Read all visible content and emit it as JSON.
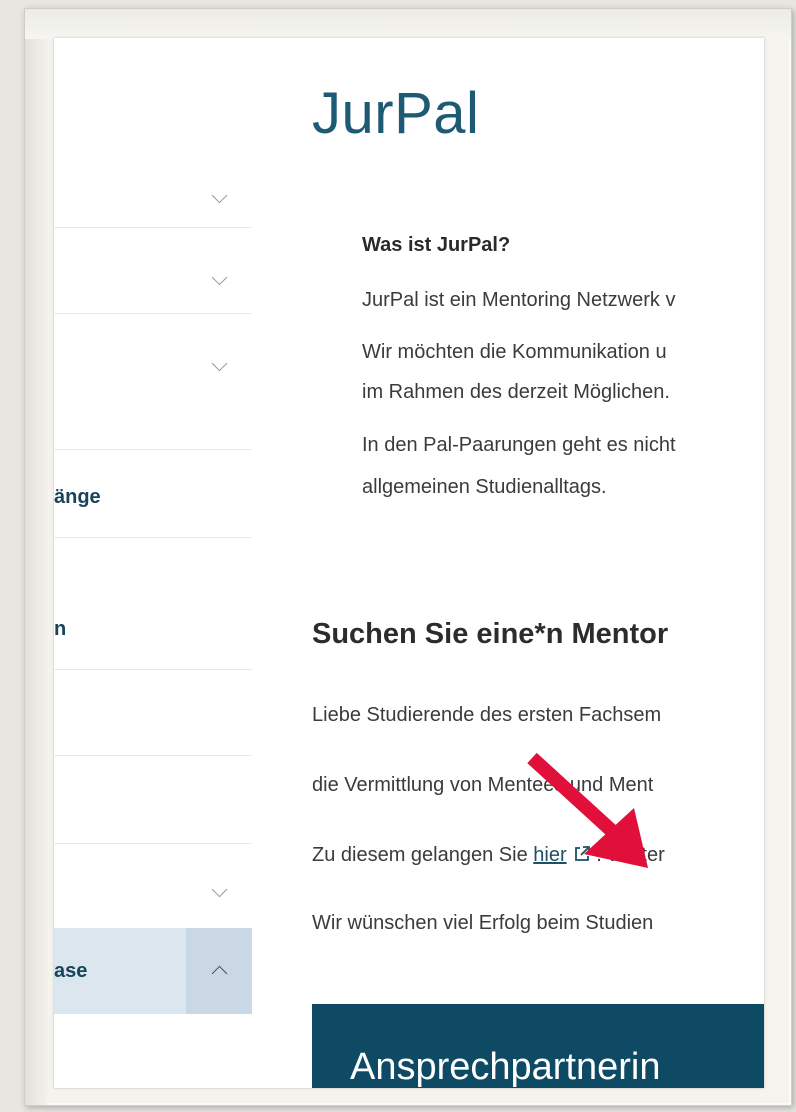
{
  "page": {
    "title": "JurPal"
  },
  "sidebar": {
    "items": [
      {
        "label": ""
      },
      {
        "label": ""
      },
      {
        "label": ""
      },
      {
        "label": "änge"
      },
      {
        "label": "n"
      },
      {
        "label": ""
      },
      {
        "label": ""
      },
      {
        "label": ""
      },
      {
        "label": "ase"
      }
    ]
  },
  "intro": {
    "heading": "Was ist JurPal?",
    "line1": "JurPal ist ein Mentoring Netzwerk v",
    "line2": "Wir möchten die Kommunikation u",
    "line3": "im Rahmen des derzeit Möglichen.",
    "line4": "In den Pal-Paarungen geht es nicht",
    "line5": "allgemeinen Studienalltags."
  },
  "mentor": {
    "heading": "Suchen Sie eine*n Mentor",
    "line1": "Liebe Studierende des ersten Fachsem",
    "line2": "die Vermittlung von Mentees und Ment",
    "line3_prefix": "Zu diesem gelangen Sie",
    "line3_link": "hier",
    "line3_suffix": ". Weiter",
    "line4": "Wir wünschen viel Erfolg beim Studien"
  },
  "contact": {
    "label": "Ansprechpartnerin"
  },
  "colors": {
    "primary": "#0e4a63",
    "title": "#1d5a74",
    "annotation_arrow": "#e0103a",
    "active_nav_bg": "#dbe6ef"
  },
  "icons": {
    "external_link": "external-link-icon",
    "chevron_down": "chevron-down-icon",
    "chevron_up": "chevron-up-icon"
  }
}
